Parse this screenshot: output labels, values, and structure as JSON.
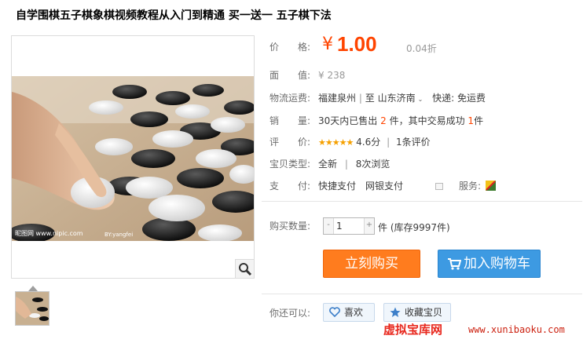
{
  "title": "自学围棋五子棋象棋视频教程从入门到精通 买一送一 五子棋下法",
  "gallery": {
    "watermark_left": "昵图网 www.nipic.com",
    "watermark_mid": "BY:yangfei"
  },
  "price": {
    "label": "价　　格:",
    "symbol": "¥",
    "value": "1.00",
    "discount": "0.04折"
  },
  "face_value": {
    "label": "面　　值:",
    "value": "¥ 238"
  },
  "shipping": {
    "label": "物流运费:",
    "from": "福建泉州",
    "sep": "|",
    "to_prefix": "至",
    "to": "山东济南",
    "express": "快递: 免运费"
  },
  "sales": {
    "label": "销　　量:",
    "prefix": "30天内已售出",
    "sold": "2",
    "mid": "件，其中交易成功",
    "success": "1",
    "suffix": "件"
  },
  "rating": {
    "label": "评　　价:",
    "stars": "★★★★★",
    "score": "4.6分",
    "sep": "|",
    "reviews": "1条评价"
  },
  "item_type": {
    "label": "宝贝类型:",
    "value": "全新",
    "sep": "|",
    "views": "8次浏览"
  },
  "payment": {
    "label": "支　　付:",
    "methods": "快捷支付　网银支付",
    "service_label": "服务:"
  },
  "quantity": {
    "label": "购买数量:",
    "value": "1",
    "minus": "-",
    "plus": "+",
    "stock": "件 (库存9997件)"
  },
  "buttons": {
    "buy": "立刻购买",
    "cart": "加入购物车"
  },
  "also": {
    "label": "你还可以:",
    "like": "喜欢",
    "favorite": "收藏宝贝"
  },
  "site": {
    "name": "虚拟宝库网",
    "url": "www.xunibaoku.com"
  },
  "colors": {
    "accent": "#ff4400",
    "buy": "#ff7c1e",
    "cart": "#3d9ae2",
    "star": "#f5a000"
  }
}
